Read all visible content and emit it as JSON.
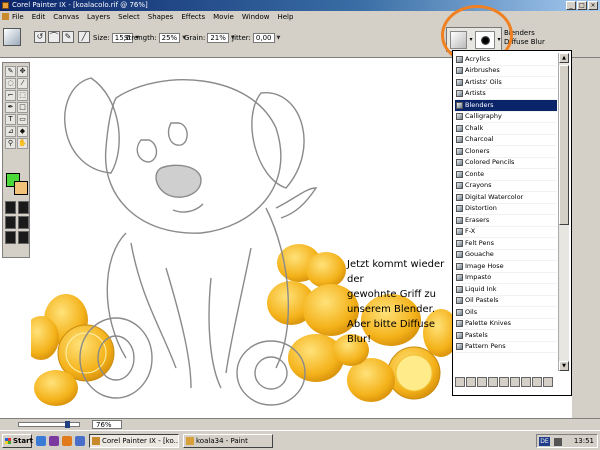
{
  "window": {
    "title": "Corel Painter IX - [koalacolo.rif @ 76%]",
    "controls": [
      "_",
      "□",
      "×"
    ]
  },
  "menu": {
    "items": [
      "File",
      "Edit",
      "Canvas",
      "Layers",
      "Select",
      "Shapes",
      "Effects",
      "Movie",
      "Window",
      "Help"
    ]
  },
  "property_bar": {
    "size_label": "Size:",
    "size_value": "15,6",
    "strength_label": "Strength:",
    "strength_value": "25%",
    "grain_label": "Grain:",
    "grain_value": "21%",
    "jitter_label": "Jitter:",
    "jitter_value": "0,00"
  },
  "brush_selector": {
    "category": "Blenders",
    "variant": "Diffuse Blur"
  },
  "brush_categories": [
    {
      "label": "Acrylics",
      "selected": false
    },
    {
      "label": "Airbrushes",
      "selected": false
    },
    {
      "label": "Artists' Oils",
      "selected": false
    },
    {
      "label": "Artists",
      "selected": false
    },
    {
      "label": "Blenders",
      "selected": true
    },
    {
      "label": "Calligraphy",
      "selected": false
    },
    {
      "label": "Chalk",
      "selected": false
    },
    {
      "label": "Charcoal",
      "selected": false
    },
    {
      "label": "Cloners",
      "selected": false
    },
    {
      "label": "Colored Pencils",
      "selected": false
    },
    {
      "label": "Conte",
      "selected": false
    },
    {
      "label": "Crayons",
      "selected": false
    },
    {
      "label": "Digital Watercolor",
      "selected": false
    },
    {
      "label": "Distortion",
      "selected": false
    },
    {
      "label": "Erasers",
      "selected": false
    },
    {
      "label": "F-X",
      "selected": false
    },
    {
      "label": "Felt Pens",
      "selected": false
    },
    {
      "label": "Gouache",
      "selected": false
    },
    {
      "label": "Image Hose",
      "selected": false
    },
    {
      "label": "Impasto",
      "selected": false
    },
    {
      "label": "Liquid Ink",
      "selected": false
    },
    {
      "label": "Oil Pastels",
      "selected": false
    },
    {
      "label": "Oils",
      "selected": false
    },
    {
      "label": "Palette Knives",
      "selected": false
    },
    {
      "label": "Pastels",
      "selected": false
    },
    {
      "label": "Pattern Pens",
      "selected": false
    }
  ],
  "caption": {
    "line1": "Jetzt kommt wieder der",
    "line2": "gewohnte Griff zu",
    "line3": "unserem Blender.",
    "line4": "Aber bitte Diffuse Blur!"
  },
  "status": {
    "zoom": "76%",
    "zoom_fraction": 0.76
  },
  "taskbar": {
    "start": "Start",
    "tasks": [
      {
        "label": "Corel Painter IX - [ko...",
        "active": true
      },
      {
        "label": "koala34 - Paint",
        "active": false
      }
    ],
    "lang": "DE",
    "clock": "13:51"
  },
  "colors": {
    "primary": "#4ad83a",
    "secondary": "#f3c27a",
    "highlight_circle": "#f08020",
    "selection": "#0a246a"
  }
}
